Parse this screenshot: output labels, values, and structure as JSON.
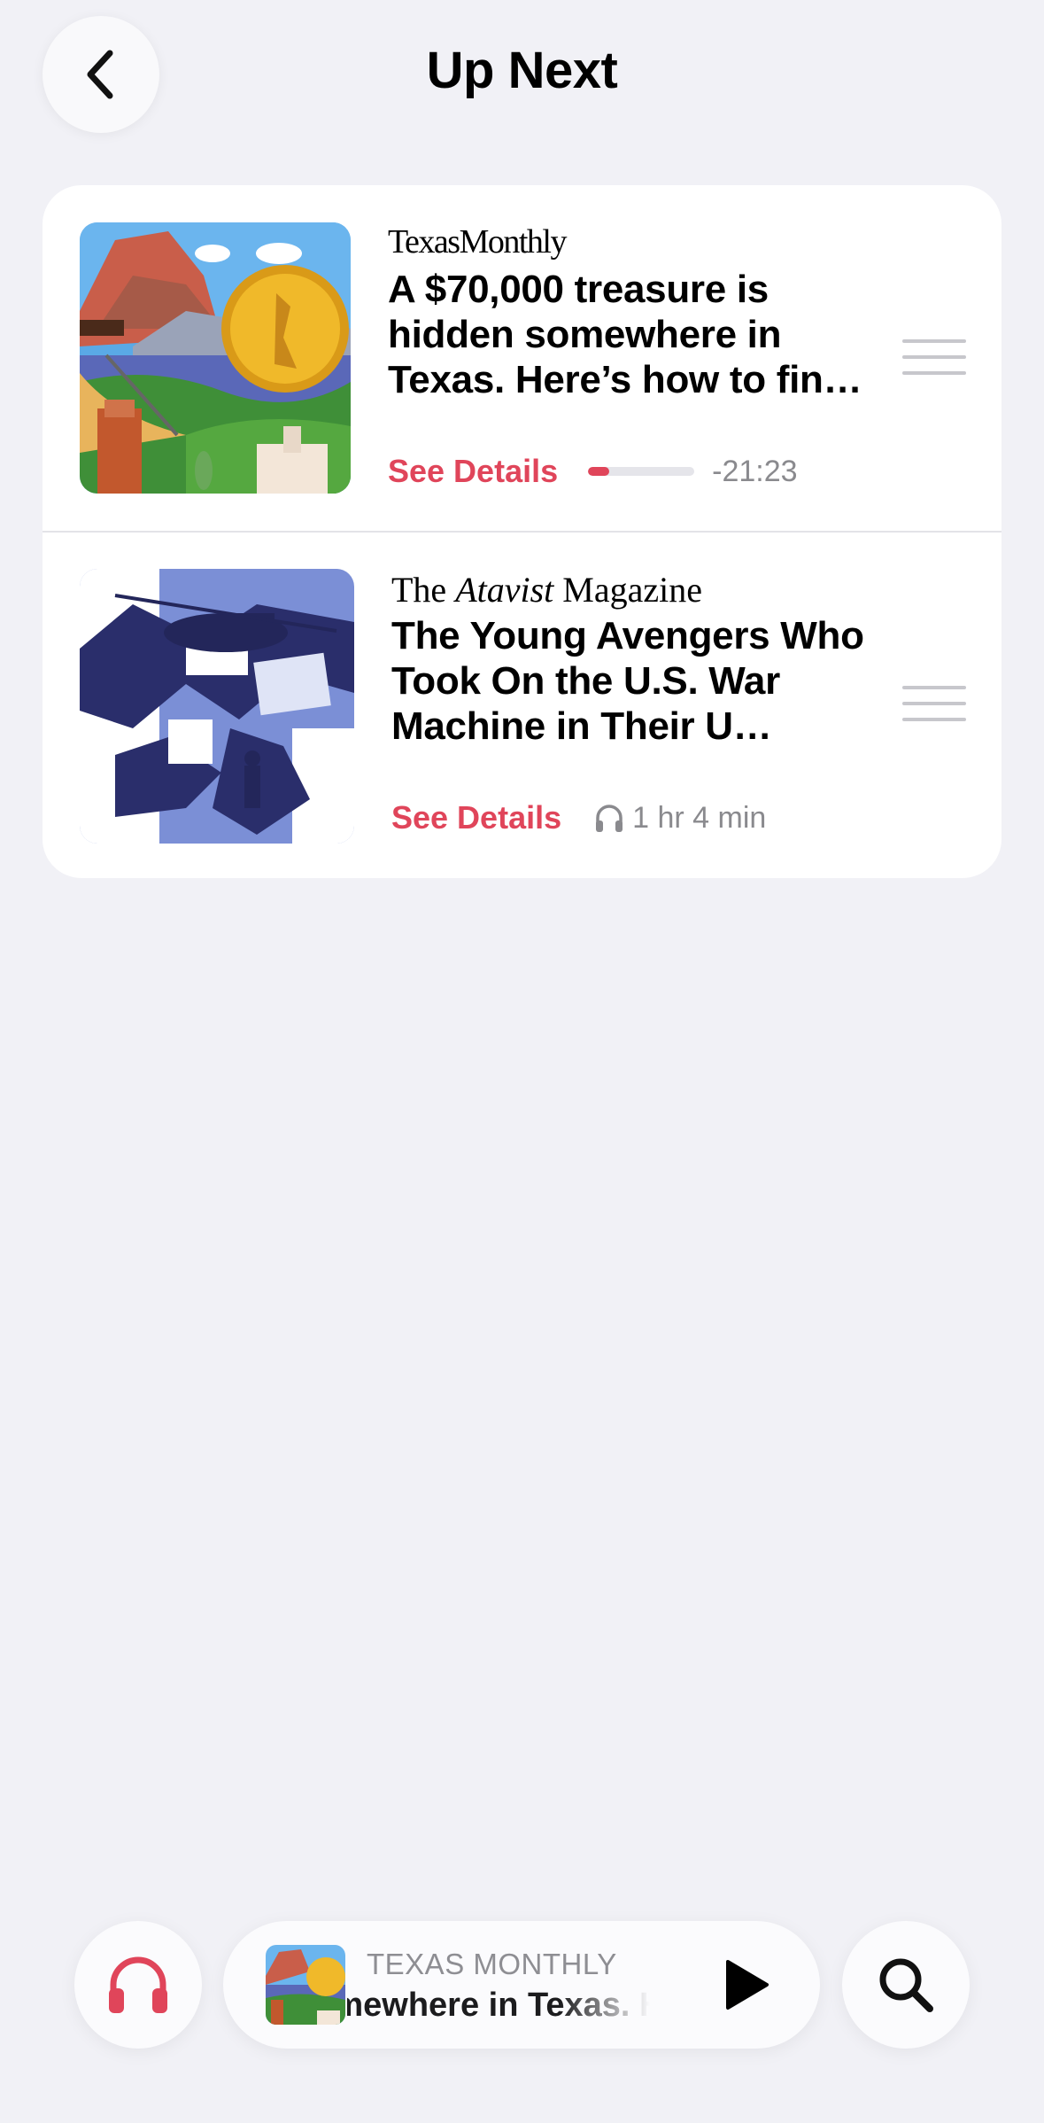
{
  "header": {
    "title": "Up Next",
    "back_icon": "chevron-left-icon"
  },
  "queue": [
    {
      "publisher": "TexasMonthly",
      "headline": "A $70,000 treasure is hidden somewhere in Texas. Here’s how to fin…",
      "details_label": "See Details",
      "progress": 0.2,
      "time_remaining": "-21:23"
    },
    {
      "publisher_pre": "The ",
      "publisher_em": "Atavist",
      "publisher_post": " Magazine",
      "headline": "The Young Avengers Who Took On the U.S. War Machine in Their U…",
      "details_label": "See Details",
      "duration": "1 hr 4 min"
    }
  ],
  "mini_player": {
    "publisher": "TEXAS MONTHLY",
    "title": "somewhere in Texas. Here’s how to find it",
    "play_icon": "play-icon"
  },
  "bottom": {
    "listen_icon": "headphones-icon",
    "search_icon": "search-icon"
  },
  "colors": {
    "accent": "#e0455a",
    "background": "#f1f1f6",
    "secondary_text": "#8a8a8e"
  }
}
